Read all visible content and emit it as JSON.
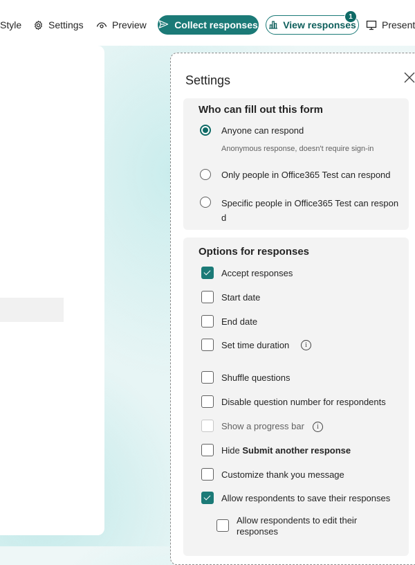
{
  "toolbar": {
    "style_label": "Style",
    "settings_label": "Settings",
    "preview_label": "Preview",
    "collect_label": "Collect responses",
    "view_label": "View responses",
    "view_badge": "1",
    "present_label": "Present"
  },
  "panel": {
    "title": "Settings",
    "who_section": {
      "title": "Who can fill out this form",
      "options": [
        {
          "label": "Anyone can respond",
          "selected": true,
          "sub": "Anonymous response, doesn't require sign-in"
        },
        {
          "label": "Only people in Office365 Test can respond",
          "selected": false
        },
        {
          "label_line1": "Specific people in Office365 Test can respon",
          "label_line2": "d",
          "selected": false
        }
      ]
    },
    "options_section": {
      "title": "Options for responses",
      "items": [
        {
          "label": "Accept responses",
          "checked": true
        },
        {
          "label": "Start date",
          "checked": false
        },
        {
          "label": "End date",
          "checked": false
        },
        {
          "label": "Set time duration",
          "checked": false,
          "info": "i"
        },
        {
          "label": "Shuffle questions",
          "checked": false
        },
        {
          "label": "Disable question number for respondents",
          "checked": false
        },
        {
          "label": "Show a progress bar",
          "checked": false,
          "disabled": true,
          "info": "i"
        },
        {
          "label_prefix": "Hide ",
          "label_bold": "Submit another response",
          "checked": false
        },
        {
          "label": "Customize thank you message",
          "checked": false
        },
        {
          "label": "Allow respondents to save their responses",
          "checked": true
        },
        {
          "label_line1": "Allow respondents to edit their",
          "label_line2": "responses",
          "checked": false
        }
      ]
    }
  },
  "colors": {
    "accent": "#1b7a77",
    "accent_dark": "#0f6a66",
    "section_bg": "#f3f3f3"
  }
}
